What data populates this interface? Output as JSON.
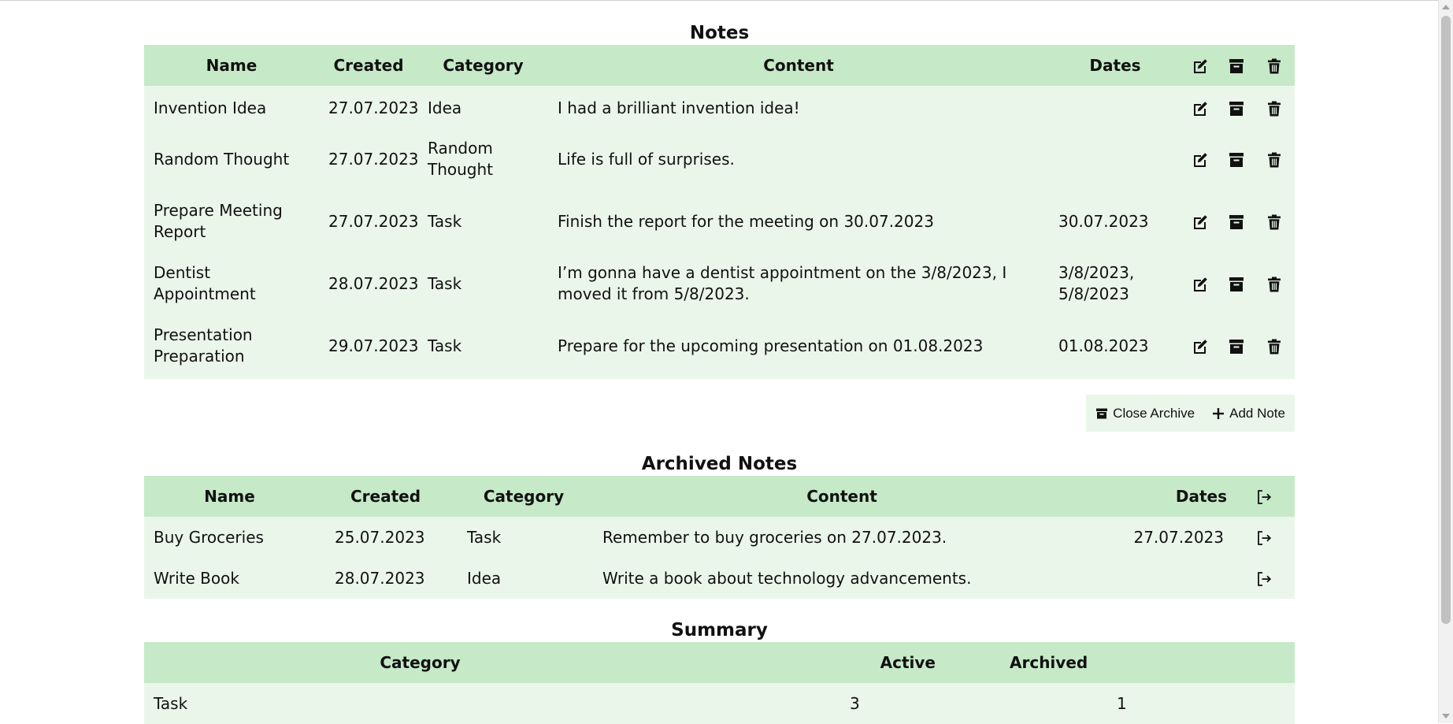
{
  "notes": {
    "title": "Notes",
    "headers": {
      "name": "Name",
      "created": "Created",
      "category": "Category",
      "content": "Content",
      "dates": "Dates"
    },
    "rows": [
      {
        "name": "Invention Idea",
        "created": "27.07.2023",
        "category": "Idea",
        "content": "I had a brilliant invention idea!",
        "dates": ""
      },
      {
        "name": "Random Thought",
        "created": "27.07.2023",
        "category": "Random Thought",
        "content": "Life is full of surprises.",
        "dates": ""
      },
      {
        "name": "Prepare Meeting Report",
        "created": "27.07.2023",
        "category": "Task",
        "content": "Finish the report for the meeting on 30.07.2023",
        "dates": "30.07.2023"
      },
      {
        "name": "Dentist Appointment",
        "created": "28.07.2023",
        "category": "Task",
        "content": "I’m gonna have a dentist appointment on the 3/8/2023, I moved it from 5/8/2023.",
        "dates": "3/8/2023, 5/8/2023"
      },
      {
        "name": "Presentation Preparation",
        "created": "29.07.2023",
        "category": "Task",
        "content": "Prepare for the upcoming presentation on 01.08.2023",
        "dates": "01.08.2023"
      }
    ]
  },
  "toolbar": {
    "close_archive_label": "Close Archive",
    "add_note_label": "Add Note"
  },
  "archived": {
    "title": "Archived Notes",
    "headers": {
      "name": "Name",
      "created": "Created",
      "category": "Category",
      "content": "Content",
      "dates": "Dates"
    },
    "rows": [
      {
        "name": "Buy Groceries",
        "created": "25.07.2023",
        "category": "Task",
        "content": "Remember to buy groceries on 27.07.2023.",
        "dates": "27.07.2023"
      },
      {
        "name": "Write Book",
        "created": "28.07.2023",
        "category": "Idea",
        "content": "Write a book about technology advancements.",
        "dates": ""
      }
    ]
  },
  "summary": {
    "title": "Summary",
    "headers": {
      "category": "Category",
      "active": "Active",
      "archived": "Archived"
    },
    "rows": [
      {
        "category": "Task",
        "active": "3",
        "archived": "1"
      }
    ]
  },
  "icons": {
    "edit": "edit-icon",
    "archive": "archive-icon",
    "delete": "trash-icon",
    "unarchive": "unarchive-icon",
    "plus": "plus-icon"
  },
  "colors": {
    "header_bg": "#c6e9c8",
    "row_bg": "#ebf6ea"
  }
}
